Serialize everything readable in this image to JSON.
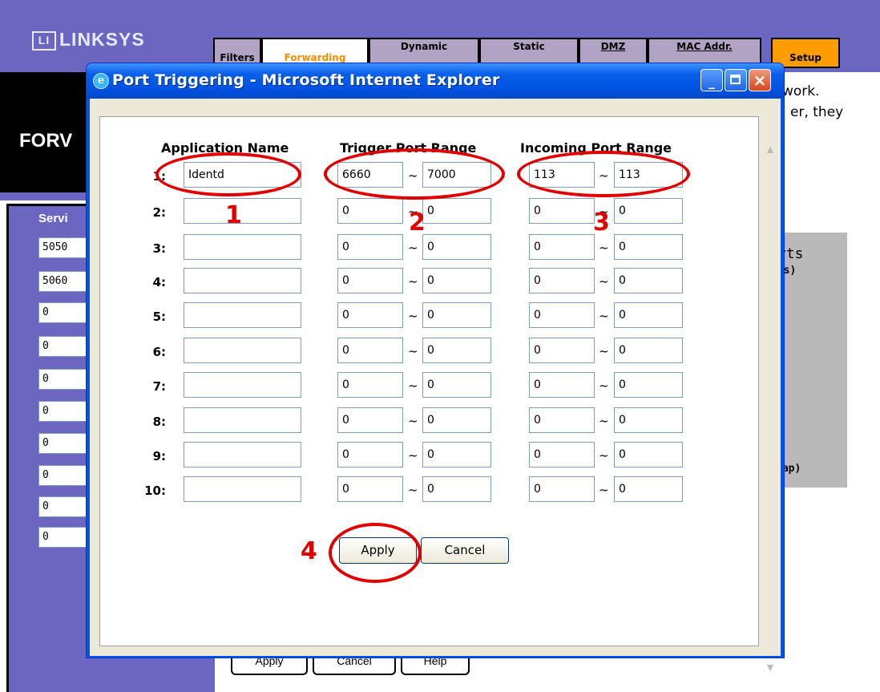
{
  "background": {
    "logo": "LINKSYS",
    "tabs": [
      "Filters",
      "Forwarding",
      "Dynamic",
      "Static",
      "DMZ",
      "MAC Addr.",
      "Setup"
    ],
    "section_title": "FORV",
    "text_line1": "work.",
    "text_line2": "er, they",
    "services_label": "Servi",
    "service_values": [
      "5050",
      "5060",
      "0",
      "0",
      "0",
      "0",
      "0",
      "0",
      "0",
      "0"
    ],
    "panel_text1": "rts",
    "panel_text2": "rts)",
    "panel_text3": ")",
    "panel_text4": "rap)",
    "buttons": [
      "Apply",
      "Cancel",
      "Help"
    ]
  },
  "window": {
    "title": "Port Triggering - Microsoft Internet Explorer",
    "minimize": "_",
    "close": "×"
  },
  "table": {
    "headers": {
      "app_name": "Application Name",
      "trigger": "Trigger Port Range",
      "incoming": "Incoming Port Range"
    },
    "tilde": "~",
    "rows": [
      {
        "num": "1:",
        "name": "Identd",
        "trig_start": "6660",
        "trig_end": "7000",
        "in_start": "113",
        "in_end": "113"
      },
      {
        "num": "2:",
        "name": "",
        "trig_start": "0",
        "trig_end": "0",
        "in_start": "0",
        "in_end": "0"
      },
      {
        "num": "3:",
        "name": "",
        "trig_start": "0",
        "trig_end": "0",
        "in_start": "0",
        "in_end": "0"
      },
      {
        "num": "4:",
        "name": "",
        "trig_start": "0",
        "trig_end": "0",
        "in_start": "0",
        "in_end": "0"
      },
      {
        "num": "5:",
        "name": "",
        "trig_start": "0",
        "trig_end": "0",
        "in_start": "0",
        "in_end": "0"
      },
      {
        "num": "6:",
        "name": "",
        "trig_start": "0",
        "trig_end": "0",
        "in_start": "0",
        "in_end": "0"
      },
      {
        "num": "7:",
        "name": "",
        "trig_start": "0",
        "trig_end": "0",
        "in_start": "0",
        "in_end": "0"
      },
      {
        "num": "8:",
        "name": "",
        "trig_start": "0",
        "trig_end": "0",
        "in_start": "0",
        "in_end": "0"
      },
      {
        "num": "9:",
        "name": "",
        "trig_start": "0",
        "trig_end": "0",
        "in_start": "0",
        "in_end": "0"
      },
      {
        "num": "10:",
        "name": "",
        "trig_start": "0",
        "trig_end": "0",
        "in_start": "0",
        "in_end": "0"
      }
    ]
  },
  "buttons": {
    "apply": "Apply",
    "cancel": "Cancel"
  },
  "annotations": {
    "n1": "1",
    "n2": "2",
    "n3": "3",
    "n4": "4",
    "color": "#e00000"
  }
}
